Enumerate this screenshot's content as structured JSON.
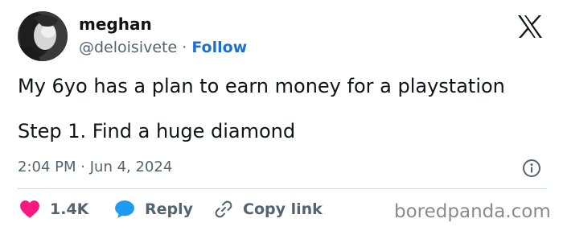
{
  "author": {
    "name": "meghan",
    "handle": "@deloisivete",
    "separator": "·",
    "follow_label": "Follow"
  },
  "tweet": {
    "line1": "My 6yo has a plan to earn money for a playstation",
    "line2": "Step 1. Find a huge diamond"
  },
  "meta": {
    "time": "2:04 PM",
    "separator": "·",
    "date": "Jun 4, 2024"
  },
  "actions": {
    "like_count": "1.4K",
    "reply_label": "Reply",
    "copy_link_label": "Copy link"
  },
  "watermark": "boredpanda.com",
  "icons": {
    "x_logo": "x-logo-icon",
    "info": "info-icon",
    "heart": "heart-icon",
    "reply": "speech-bubble-icon",
    "copy_link": "link-icon"
  },
  "colors": {
    "heart": "#f91880",
    "reply": "#1d9bf0",
    "follow": "#1d6fd1",
    "muted": "#536471"
  }
}
